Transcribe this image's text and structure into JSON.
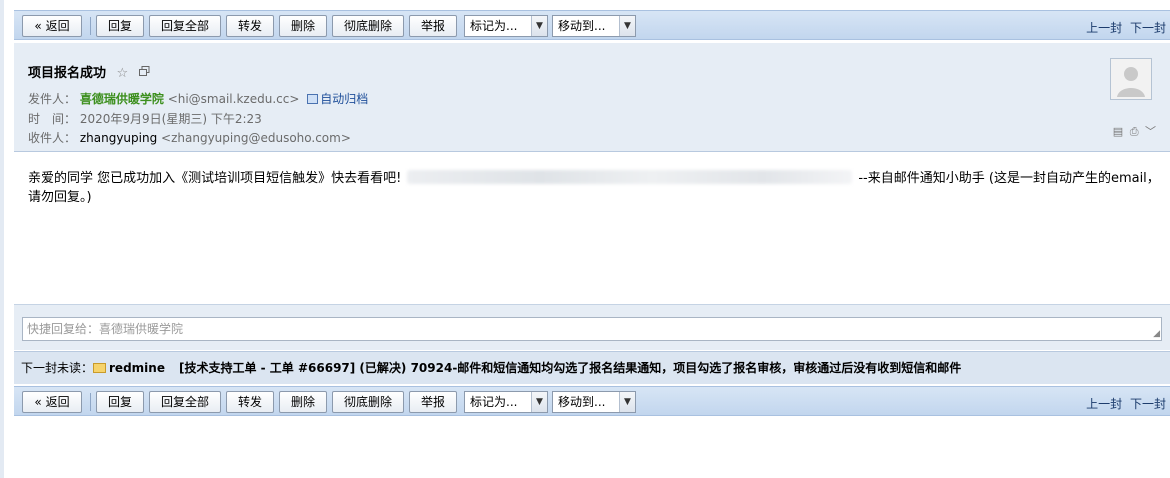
{
  "toolbar": {
    "back": "« 返回",
    "reply": "回复",
    "reply_all": "回复全部",
    "forward": "转发",
    "delete": "删除",
    "delete_permanent": "彻底删除",
    "report": "举报",
    "mark_as": "标记为...",
    "move_to": "移动到...",
    "prev": "上一封",
    "next": "下一封"
  },
  "email": {
    "subject": "项目报名成功",
    "from_label": "发件人：",
    "from_name": "喜德瑞供暖学院",
    "from_address": "<hi@smail.kzedu.cc>",
    "auto_archive": "自动归档",
    "time_label": "时　间：",
    "time_value": "2020年9月9日(星期三) 下午2:23",
    "to_label": "收件人：",
    "to_name": "zhangyuping",
    "to_address": "<zhangyuping@edusoho.com>",
    "body_before": "亲爱的同学 您已成功加入《测试培训项目短信触发》快去看看吧!",
    "body_after": "--来自邮件通知小助手 (这是一封自动产生的email，请勿回复。)"
  },
  "quick_reply": {
    "placeholder": "快捷回复给：喜德瑞供暖学院"
  },
  "next_unread": {
    "label": "下一封未读：",
    "from": "redmine",
    "subject": "[技术支持工单 - 工单 #66697] (已解决) 70924-邮件和短信通知均勾选了报名结果通知，项目勾选了报名审核，审核通过后没有收到短信和邮件"
  },
  "icons": {
    "star": "star-icon",
    "popout": "popout-icon",
    "archive": "archive-icon",
    "avatar": "avatar-icon",
    "envelope": "envelope-icon"
  },
  "colors": {
    "toolbar_bg": "#c9dbf0",
    "header_bg": "#e6edf5",
    "sender_green": "#3c8f1d",
    "link_blue": "#1f4f9a"
  }
}
